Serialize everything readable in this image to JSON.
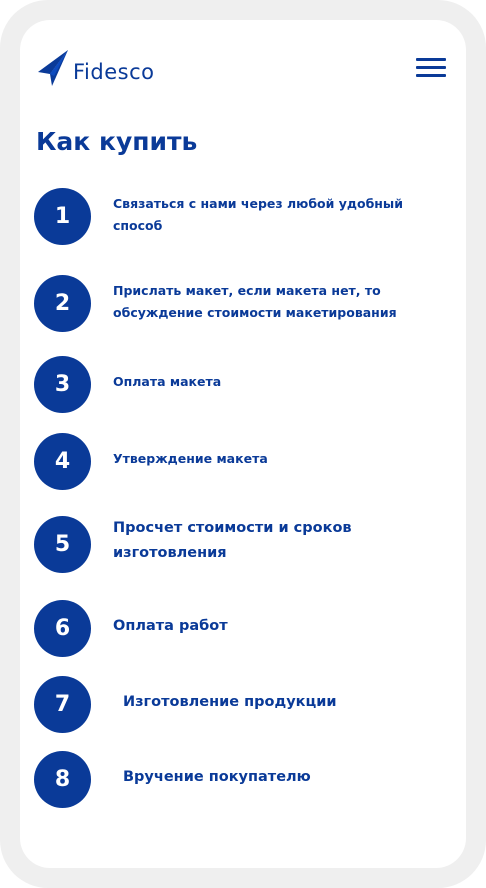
{
  "header": {
    "logo_text": "Fidesco",
    "logo_icon": "paper-plane-logo-icon",
    "menu_icon": "hamburger-menu-icon"
  },
  "page": {
    "title": "Как купить"
  },
  "steps": [
    {
      "number": "1",
      "text": "Связаться с нами через любой удобный способ"
    },
    {
      "number": "2",
      "text": "Прислать макет, если макета нет, то обсуждение стоимости макетирования"
    },
    {
      "number": "3",
      "text": "Оплата макета"
    },
    {
      "number": "4",
      "text": "Утверждение макета"
    },
    {
      "number": "5",
      "text": "Просчет стоимости и сроков изготовления"
    },
    {
      "number": "6",
      "text": "Оплата работ"
    },
    {
      "number": "7",
      "text": "Изготовление продукции"
    },
    {
      "number": "8",
      "text": "Вручение покупателю"
    }
  ],
  "colors": {
    "brand": "#0a3a98",
    "frame": "#efefef",
    "background": "#ffffff"
  }
}
